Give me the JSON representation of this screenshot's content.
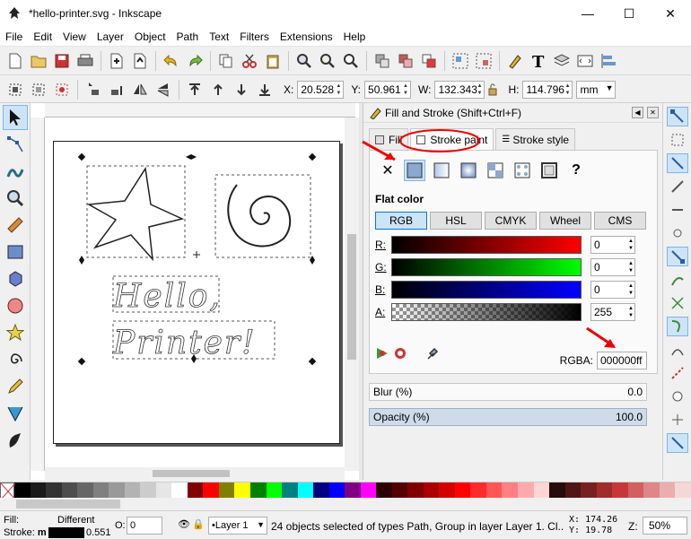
{
  "window": {
    "title": "*hello-printer.svg - Inkscape",
    "min": "—",
    "max": "☐",
    "close": "✕"
  },
  "menu": [
    "File",
    "Edit",
    "View",
    "Layer",
    "Object",
    "Path",
    "Text",
    "Filters",
    "Extensions",
    "Help"
  ],
  "toolbar1_icons": [
    "new-document-icon",
    "open-icon",
    "save-icon",
    "print-icon",
    "import-icon",
    "export-icon",
    "undo-icon",
    "redo-icon",
    "copy-icon",
    "cut-icon",
    "paste-icon",
    "zoom-selection-icon",
    "zoom-drawing-icon",
    "zoom-page-icon",
    "duplicate-icon",
    "clone-icon",
    "unlink-clone-icon",
    "group-icon",
    "ungroup-icon",
    "fill-stroke-icon",
    "text-font-icon",
    "layers-icon",
    "xml-editor-icon",
    "align-icon"
  ],
  "coords": {
    "x_label": "X:",
    "x_value": "20.528",
    "y_label": "Y:",
    "y_value": "50.961",
    "w_label": "W:",
    "w_value": "132.343",
    "h_label": "H:",
    "h_value": "114.796",
    "unit": "mm"
  },
  "canvas": {
    "hello_text": "Hello,",
    "printer_text": "Printer!"
  },
  "dialog": {
    "title": "Fill and Stroke (Shift+Ctrl+F)",
    "tabs": [
      "Fill",
      "Stroke paint",
      "Stroke style"
    ],
    "flat_label": "Flat color",
    "help_glyph": "?",
    "none_glyph": "✕",
    "models": [
      "RGB",
      "HSL",
      "CMYK",
      "Wheel",
      "CMS"
    ],
    "channels": [
      {
        "label": "R:",
        "value": "0",
        "color": "#ff0000"
      },
      {
        "label": "G:",
        "value": "0",
        "color": "#00ff00"
      },
      {
        "label": "B:",
        "value": "0",
        "color": "#0000ff"
      },
      {
        "label": "A:",
        "value": "255",
        "color": "#000000"
      }
    ],
    "rgba_label": "RGBA:",
    "rgba_value": "000000ff",
    "blur_label": "Blur (%)",
    "blur_value": "0.0",
    "opacity_label": "Opacity (%)",
    "opacity_value": "100.0"
  },
  "palette": [
    "#000000",
    "#1a1a1a",
    "#333333",
    "#4d4d4d",
    "#666666",
    "#808080",
    "#999999",
    "#b3b3b3",
    "#cccccc",
    "#e6e6e6",
    "#ffffff",
    "#800000",
    "#ff0000",
    "#808000",
    "#ffff00",
    "#008000",
    "#00ff00",
    "#008080",
    "#00ffff",
    "#000080",
    "#0000ff",
    "#800080",
    "#ff00ff",
    "#2b0000",
    "#550000",
    "#800000",
    "#aa0000",
    "#d40000",
    "#ff0000",
    "#ff2a2a",
    "#ff5555",
    "#ff8080",
    "#ffaaaa",
    "#ffd5d5",
    "#280b0b",
    "#501616",
    "#782121",
    "#a02c2c",
    "#c83737",
    "#d35f5f",
    "#de8787",
    "#e9afaf",
    "#f4d7d7"
  ],
  "status": {
    "fill_label": "Fill:",
    "stroke_label": "Stroke:",
    "stroke_mode": "m",
    "different": "Different",
    "stroke_width": "0.551",
    "o_label": "O:",
    "o_value": "0",
    "layer": "•Layer 1",
    "message": "24 objects selected of types Path, Group in layer Layer 1. Cl...",
    "x_label": "X:",
    "x_value": "174.26",
    "y_label": "Y:",
    "y_value": "19.78",
    "z_label": "Z:",
    "zoom": "50%"
  }
}
